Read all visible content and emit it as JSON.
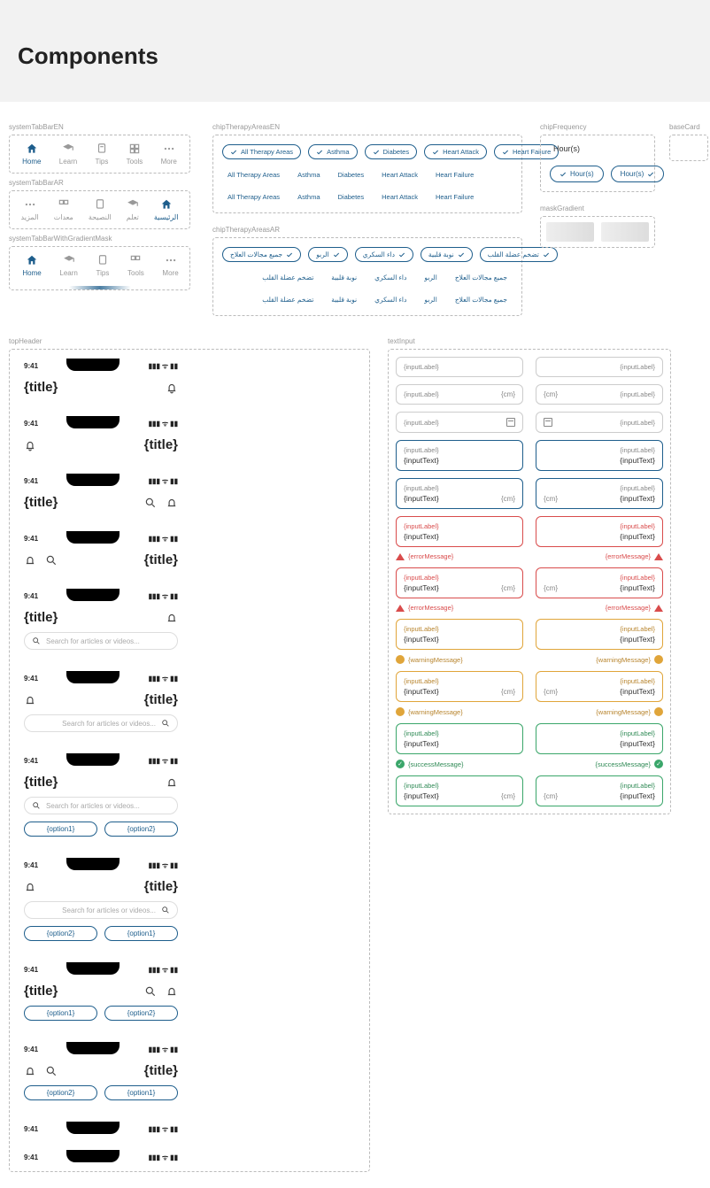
{
  "pageTitle": "Components",
  "sections": {
    "systemTabBarEN": "systemTabBarEN",
    "systemTabBarAR": "systemTabBarAR",
    "systemTabBarWithGradientMask": "systemTabBarWithGradientMask",
    "chipTherapyAreasEN": "chipTherapyAreasEN",
    "chipTherapyAreasAR": "chipTherapyAreasAR",
    "chipFrequency": "chipFrequency",
    "baseCard": "baseCard",
    "maskGradient": "maskGradient",
    "topHeader": "topHeader",
    "textInput": "textInput"
  },
  "tabsEN": [
    "Home",
    "Learn",
    "Tips",
    "Tools",
    "More"
  ],
  "tabsAR": [
    "المزيد",
    "معدات",
    "النصيحة",
    "تعلم",
    "الرئيسية"
  ],
  "chipsEN": [
    "All Therapy Areas",
    "Asthma",
    "Diabetes",
    "Heart Attack",
    "Heart Failure"
  ],
  "chipsAR": [
    "جميع مجالات العلاج",
    "الربو",
    "داء السكري",
    "نوبة قلبية",
    "تضخم عضلة القلب"
  ],
  "freq": {
    "label": "Hour(s)",
    "opt1": "Hour(s)",
    "opt2": "Hour(s)"
  },
  "statusTime": "9:41",
  "headerTitle": "{title}",
  "searchPlaceholder": "Search for articles or videos...",
  "option1": "{option1}",
  "option2": "{option2}",
  "ti": {
    "inputLabel": "{inputLabel}",
    "inputText": "{inputText}",
    "unit": "{cm}",
    "errorMessage": "{errorMessage}",
    "warningMessage": "{warningMessage}",
    "successMessage": "{successMessage}"
  }
}
